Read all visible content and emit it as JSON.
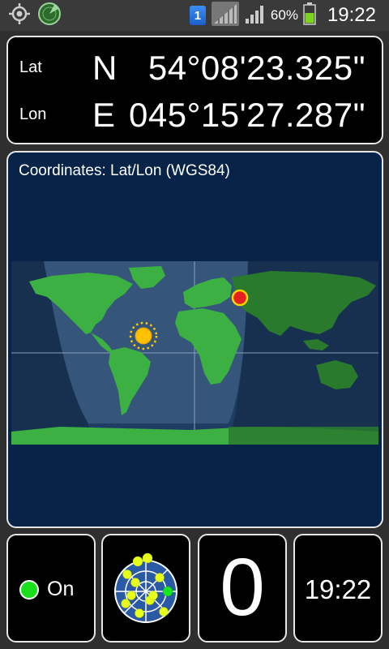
{
  "status_bar": {
    "sim_label": "1",
    "battery_percent": "60%",
    "time": "19:22",
    "icons": [
      "gps-icon",
      "radar-app-icon",
      "sim-icon",
      "signal-icon",
      "signal-icon",
      "battery-icon"
    ]
  },
  "coordinates": {
    "lat": {
      "label": "Lat",
      "hemisphere": "N",
      "value": "54°08'23.325\""
    },
    "lon": {
      "label": "Lon",
      "hemisphere": "E",
      "value": "045°15'27.287\""
    }
  },
  "map": {
    "title": "Coordinates: Lat/Lon (WGS84)"
  },
  "bottom": {
    "gps_status": "On",
    "satellite_count": "0",
    "clock": "19:22"
  },
  "colors": {
    "panel_border": "#e6e6e6",
    "map_background": "#072348",
    "land_day": "#3cb043",
    "land_night": "#2a7a2e",
    "status_on": "#17e01b",
    "sun": "#ffcc00",
    "location_marker": "#e52020"
  }
}
